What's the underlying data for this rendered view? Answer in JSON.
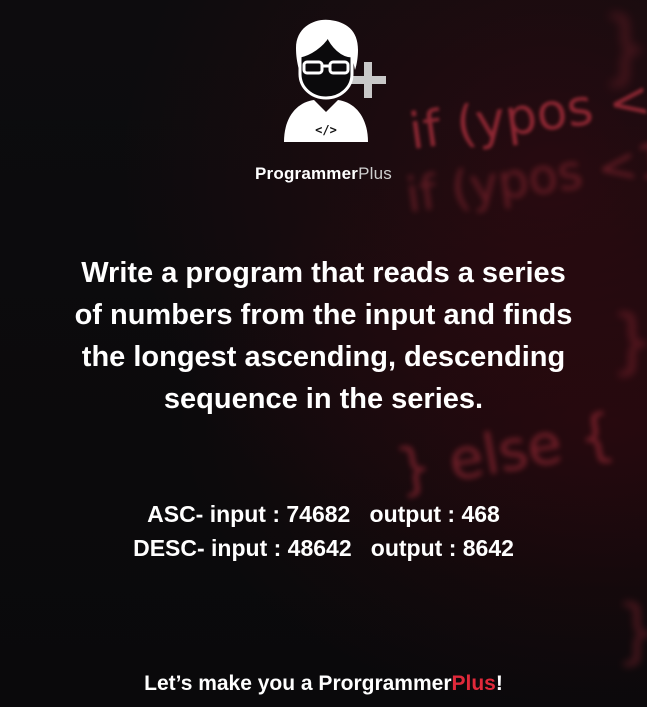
{
  "brand": {
    "name_main": "Programmer",
    "name_plus": "Plus",
    "logo_code_glyph": "</>",
    "logo_icon": "programmer-avatar-icon"
  },
  "headline": {
    "lines": [
      "Write a program that reads a series",
      "of numbers from the input and finds",
      "the longest ascending, descending",
      "sequence in the series."
    ]
  },
  "examples": [
    {
      "label": "ASC- input : 74682",
      "output": "output : 468"
    },
    {
      "label": "DESC- input : 48642",
      "output": "output : 8642"
    }
  ],
  "footer": {
    "text_main": "Let’s make you a Prorgrammer",
    "text_accent": "Plus",
    "text_end": "!"
  },
  "colors": {
    "background": "#0b0a0c",
    "accent_red": "#e0293a",
    "text": "#ffffff"
  }
}
